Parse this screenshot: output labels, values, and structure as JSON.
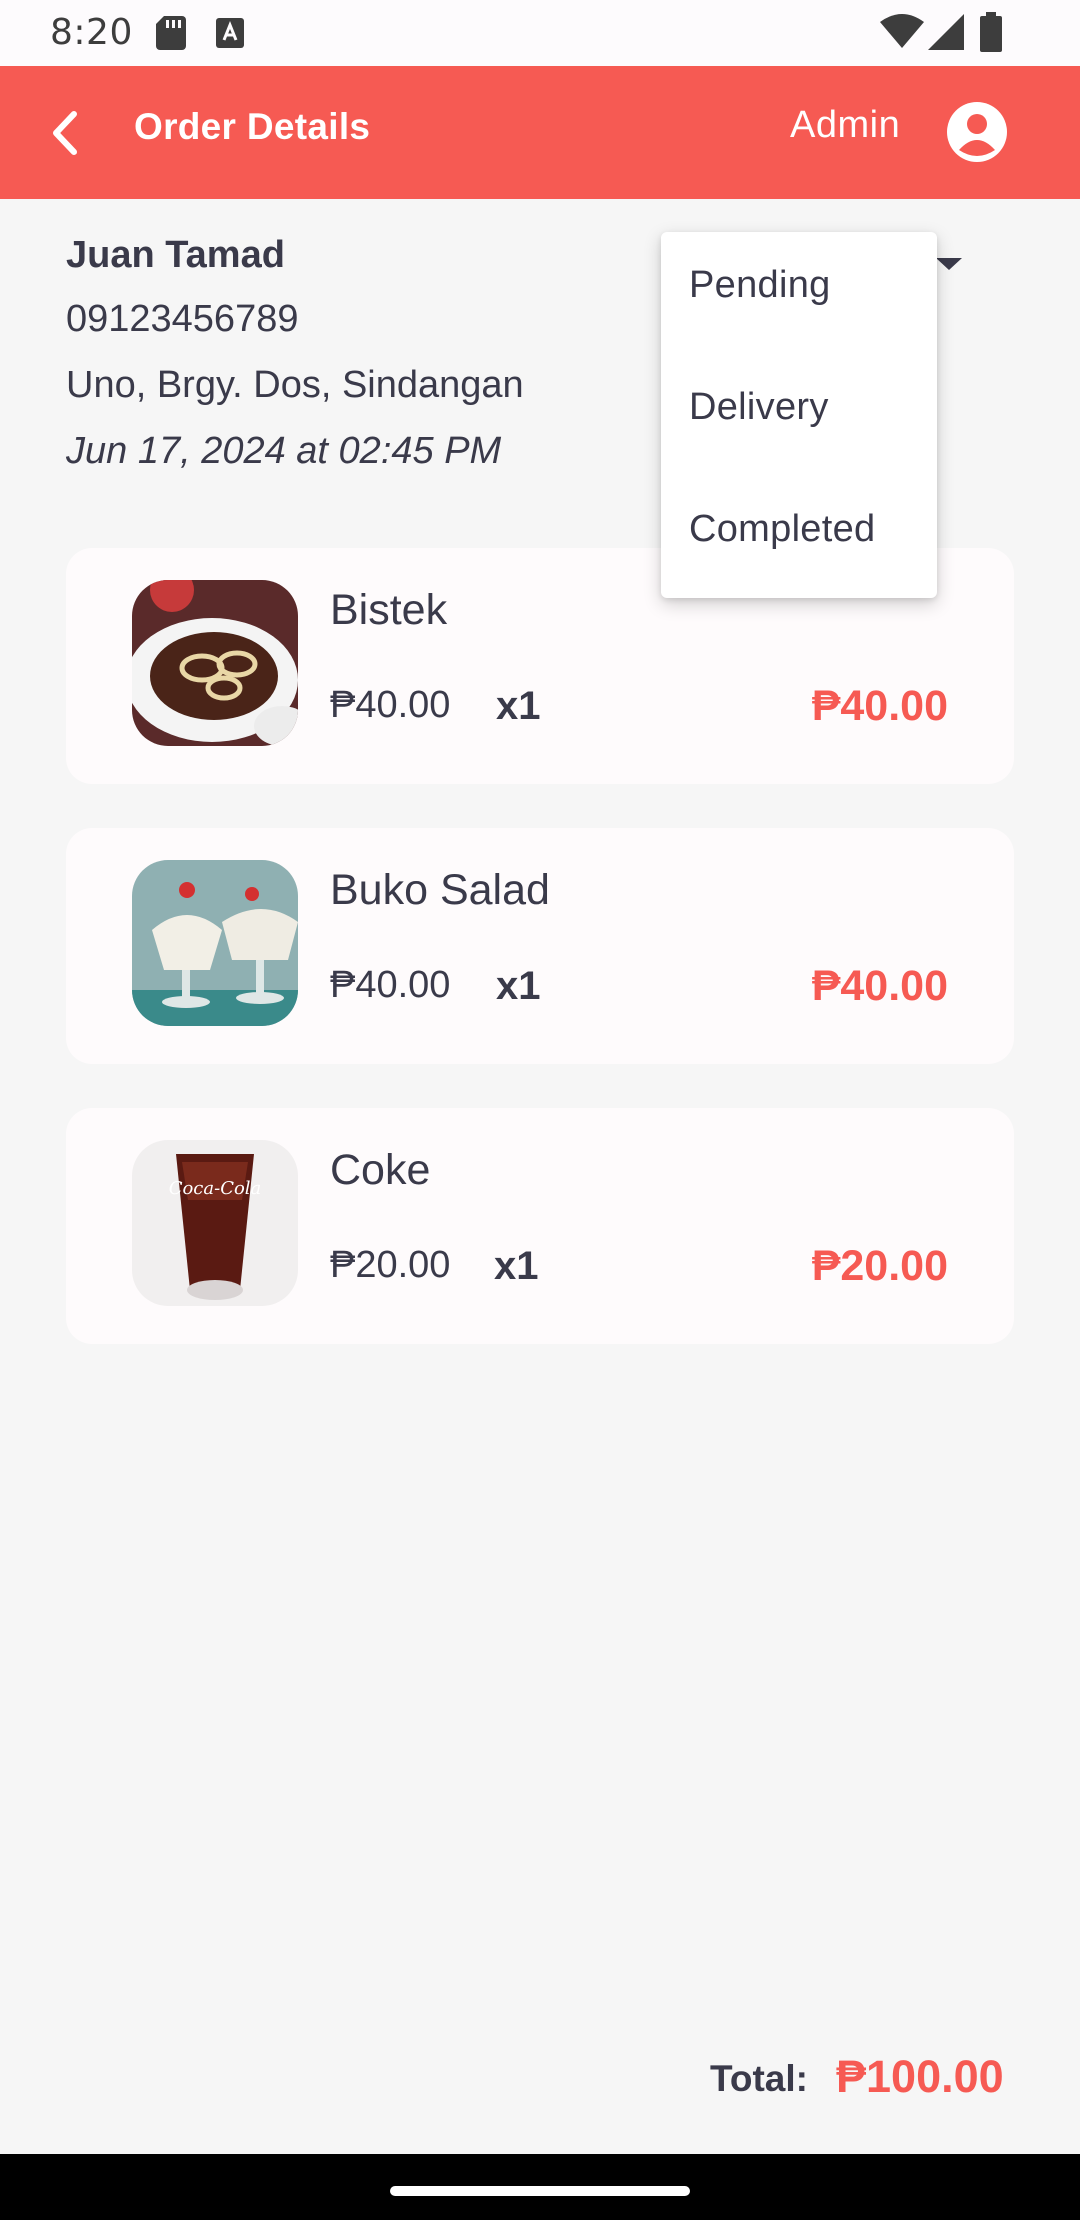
{
  "status_bar": {
    "time": "8:20",
    "icons": [
      "sd-card-icon",
      "a-icon",
      "wifi-icon",
      "signal-icon",
      "battery-icon"
    ]
  },
  "header": {
    "title": "Order Details",
    "user": "Admin",
    "back_icon": "chevron-left-icon",
    "avatar_icon": "account-circle-icon",
    "background_color": "#f65a53"
  },
  "customer": {
    "name": "Juan Tamad",
    "phone": "09123456789",
    "address": "Uno, Brgy. Dos, Sindangan",
    "date": "Jun 17, 2024 at 02:45 PM"
  },
  "status_dropdown": {
    "options": [
      "Pending",
      "Delivery",
      "Completed"
    ]
  },
  "items": [
    {
      "name": "Bistek",
      "price": "₱40.00",
      "qty": "x1",
      "subtotal": "₱40.00",
      "thumb": "bistek-image"
    },
    {
      "name": "Buko Salad",
      "price": "₱40.00",
      "qty": "x1",
      "subtotal": "₱40.00",
      "thumb": "buko-salad-image"
    },
    {
      "name": "Coke",
      "price": "₱20.00",
      "qty": "x1",
      "subtotal": "₱20.00",
      "thumb": "coke-image"
    }
  ],
  "total": {
    "label": "Total:",
    "value": "₱100.00"
  },
  "colors": {
    "accent": "#f65a53",
    "text": "#3a3a4a",
    "background": "#f6f6f6",
    "card": "#fefbfc"
  }
}
